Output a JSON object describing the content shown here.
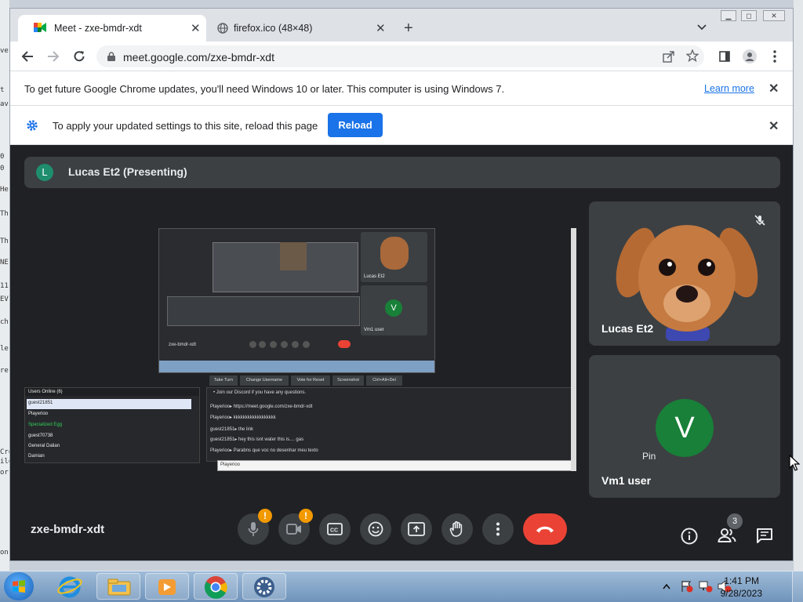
{
  "desktop": {
    "left_fragments": [
      "ve",
      "t",
      "av",
      "0",
      "0",
      "He",
      "Th",
      "Th",
      "NE",
      "11",
      "EV",
      "ch",
      "le",
      "re",
      "Cre",
      "ile",
      "or",
      "on"
    ]
  },
  "browser": {
    "tabs": [
      {
        "title": "Meet - zxe-bmdr-xdt",
        "icon": "google-meet-icon",
        "active": true
      },
      {
        "title": "firefox.ico (48×48)",
        "icon": "globe-icon",
        "active": false
      }
    ],
    "new_tab": "+",
    "url": "meet.google.com/zxe-bmdr-xdt",
    "infobar_update": {
      "text": "To get future Google Chrome updates, you'll need Windows 10 or later. This computer is using Windows 7.",
      "link": "Learn more"
    },
    "infobar_reload": {
      "text": "To apply your updated settings to this site, reload this page",
      "button": "Reload"
    }
  },
  "meet": {
    "presenter": {
      "initial": "L",
      "label": "Lucas Et2 (Presenting)"
    },
    "shared_screen": {
      "inner_meeting_code": "zxe-bmdr-xdt",
      "inner_tiles": [
        {
          "name": "Lucas Et2"
        },
        {
          "initial": "V",
          "name": "Vm1 user"
        }
      ],
      "toolbar_buttons": [
        "Take Turn",
        "Change Username",
        "Vote for Reset",
        "Screenshot",
        "Ctrl+Alt+Del"
      ],
      "users_header": "Users Online (6)",
      "users": [
        "guest21851",
        "Playerioo",
        "Specialized Egg",
        "guest70738",
        "General Dalian",
        "Damian"
      ],
      "chat_lines": [
        "• Join our Discord if you have any questions.",
        "Playerioo▸ https://meet.google.com/zxe-bmdr-xdt",
        "Playerioo▸ kkkkkkkkkkkkkkkkkk",
        "guest21851▸ the link",
        "guest21851▸ hey this isnt water this is.... gas",
        "Playerioo▸ Parabns que voc no desenhar meu texto"
      ],
      "chat_input": "Playerioo"
    },
    "tiles": [
      {
        "name": "Lucas Et2",
        "muted": true
      },
      {
        "initial": "V",
        "pin_label": "Pin",
        "name": "Vm1 user",
        "avatar_color": "#188038"
      }
    ],
    "bottom": {
      "meeting_code": "zxe-bmdr-xdt",
      "controls": [
        "mic",
        "camera",
        "captions",
        "emoji",
        "present",
        "raise-hand",
        "more",
        "leave"
      ],
      "warning_badge": "!",
      "people_count": "3"
    }
  },
  "taskbar": {
    "apps": [
      "internet-explorer",
      "file-explorer",
      "media-player",
      "chrome",
      "settings"
    ],
    "time": "1:41 PM",
    "date": "9/28/2023"
  }
}
